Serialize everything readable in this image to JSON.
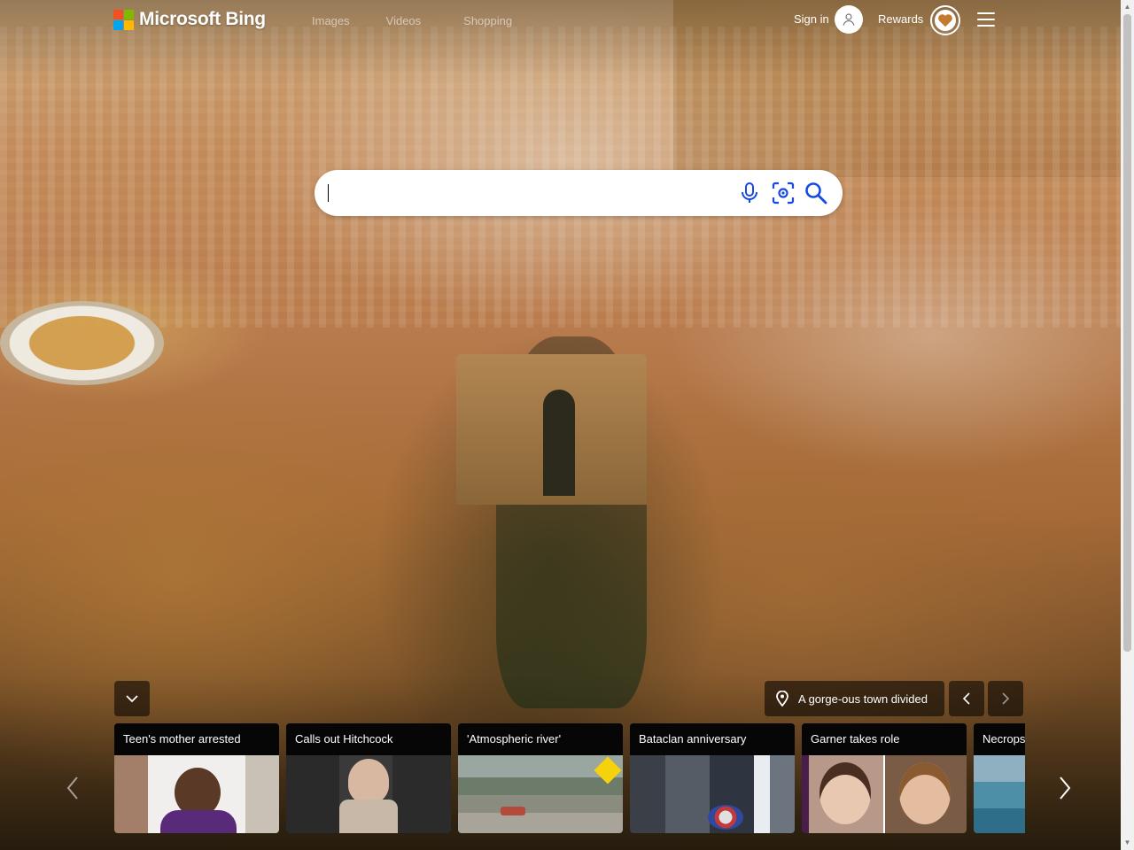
{
  "header": {
    "brand": "Microsoft Bing",
    "nav": [
      "Images",
      "Videos",
      "Shopping"
    ],
    "sign_in": "Sign in",
    "rewards": "Rewards"
  },
  "search": {
    "value": "",
    "placeholder": ""
  },
  "image_info": {
    "title": "A gorge-ous town divided"
  },
  "news": {
    "cards": [
      {
        "title": "Teen's mother arrested"
      },
      {
        "title": "Calls out Hitchcock"
      },
      {
        "title": "'Atmospheric river'"
      },
      {
        "title": "Bataclan anniversary"
      },
      {
        "title": "Garner takes role"
      },
      {
        "title": "Necropsy"
      }
    ]
  },
  "icons": {
    "brand_logo": "microsoft-logo-icon",
    "avatar": "user-icon",
    "rewards": "heart-icon",
    "menu": "hamburger-menu-icon",
    "mic": "microphone-icon",
    "visual_search": "camera-lens-icon",
    "search": "magnifier-icon",
    "collapse": "chevron-down-icon",
    "location": "location-pin-icon",
    "prev": "chevron-left-icon",
    "next": "chevron-right-icon"
  },
  "colors": {
    "ms_red": "#f25022",
    "ms_green": "#7fba00",
    "ms_blue": "#00a4ef",
    "ms_yellow": "#ffb900",
    "accent_blue": "#174ae4"
  }
}
